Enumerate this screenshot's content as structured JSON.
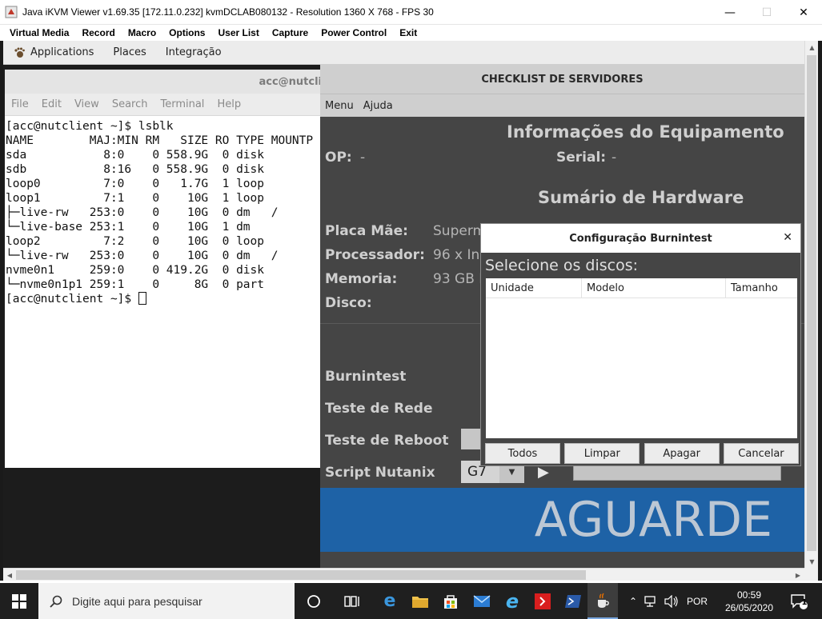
{
  "window": {
    "title": "Java iKVM Viewer v1.69.35 [172.11.0.232] kvmDCLAB080132 - Resolution 1360 X 768 - FPS 30",
    "controls": [
      "minimize",
      "maximize",
      "close"
    ]
  },
  "kvm_menu": [
    "Virtual Media",
    "Record",
    "Macro",
    "Options",
    "User List",
    "Capture",
    "Power Control",
    "Exit"
  ],
  "gnome_panel": [
    "Applications",
    "Places",
    "Integração"
  ],
  "terminal": {
    "title": "acc@nutcli",
    "menu": [
      "File",
      "Edit",
      "View",
      "Search",
      "Terminal",
      "Help"
    ],
    "lines": [
      "[acc@nutclient ~]$ lsblk",
      "NAME        MAJ:MIN RM   SIZE RO TYPE MOUNTP",
      "sda           8:0    0 558.9G  0 disk",
      "sdb           8:16   0 558.9G  0 disk",
      "loop0         7:0    0   1.7G  1 loop",
      "loop1         7:1    0    10G  1 loop",
      "├─live-rw   253:0    0    10G  0 dm   /",
      "└─live-base 253:1    0    10G  1 dm",
      "loop2         7:2    0    10G  0 loop",
      "└─live-rw   253:0    0    10G  0 dm   /",
      "nvme0n1     259:0    0 419.2G  0 disk",
      "└─nvme0n1p1 259:1    0     8G  0 part"
    ],
    "prompt": "[acc@nutclient ~]$ "
  },
  "checklist": {
    "title": "CHECKLIST DE SERVIDORES",
    "menu": [
      "Menu",
      "Ajuda"
    ],
    "info_heading": "Informações do Equipamento",
    "op_label": "OP:",
    "op_value": "-",
    "serial_label": "Serial:",
    "serial_value": "-",
    "hw_heading": "Sumário de Hardware",
    "placa_label": "Placa Mãe:",
    "placa_value": "Superm",
    "proc_label": "Processador:",
    "proc_value": "96 x In",
    "mem_label": "Memoria:",
    "mem_value": "93 GB I",
    "disco_label": "Disco:",
    "burnin_label": "Burnintest",
    "rede_label": "Teste de Rede",
    "reboot_label": "Teste de Reboot",
    "script_label": "Script Nutanix",
    "script_value": "G7",
    "status": "AGUARDE"
  },
  "dialog": {
    "title": "Configuração Burnintest",
    "prompt": "Selecione os discos:",
    "columns": [
      "Unidade",
      "Modelo",
      "Tamanho"
    ],
    "buttons": [
      "Todos",
      "Limpar",
      "Apagar",
      "Cancelar"
    ]
  },
  "taskbar": {
    "search_placeholder": "Digite aqui para pesquisar",
    "language": "POR",
    "time": "00:59",
    "date": "26/05/2020",
    "notification_count": "1"
  }
}
